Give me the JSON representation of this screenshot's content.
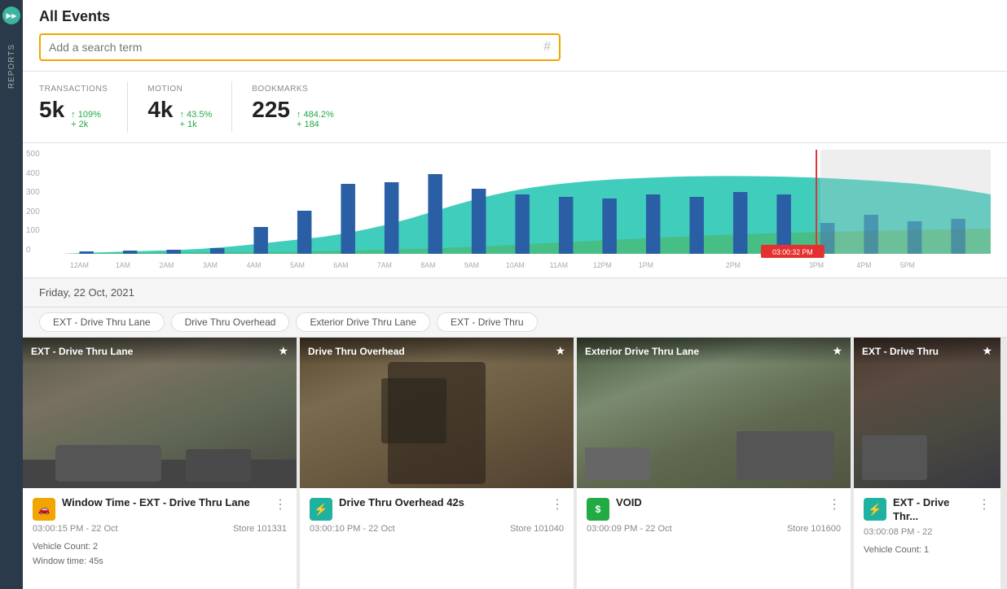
{
  "sidebar": {
    "toggle_label": "▶",
    "reports_label": "REPORTS"
  },
  "header": {
    "title": "All Events",
    "search_placeholder": "Add a search term",
    "search_hash": "#"
  },
  "stats": [
    {
      "label": "TRANSACTIONS",
      "value": "5k",
      "change1": "↑ 109%",
      "change2": "+ 2k"
    },
    {
      "label": "MOTION",
      "value": "4k",
      "change1": "↑ 43.5%",
      "change2": "+ 1k"
    },
    {
      "label": "BOOKMARKS",
      "value": "225",
      "change1": "↑ 484.2%",
      "change2": "+ 184"
    }
  ],
  "chart": {
    "y_labels": [
      "500",
      "400",
      "300",
      "200",
      "100",
      "0"
    ],
    "x_labels": [
      "12AM",
      "1AM",
      "2AM",
      "3AM",
      "4AM",
      "5AM",
      "6AM",
      "7AM",
      "8AM",
      "9AM",
      "10AM",
      "11AM",
      "12PM",
      "1PM",
      "2PM",
      "3PM",
      "4PM",
      "5PM"
    ],
    "tooltip_time": "03:00:32 PM",
    "cursor_pct": "78.5"
  },
  "date_bar": {
    "date": "Friday, 22 Oct, 2021"
  },
  "camera_tabs": [
    "EXT - Drive Thru Lane",
    "Drive Thru Overhead",
    "Exterior Drive Thru Lane",
    "EXT - Drive Thru"
  ],
  "video_cards": [
    {
      "title": "EXT - Drive Thru Lane",
      "event_name": "Window Time - EXT - Drive Thru Lane",
      "time": "03:00:15 PM - 22 Oct",
      "store": "Store 101331",
      "icon_type": "orange",
      "icon_symbol": "🚗",
      "detail1": "Vehicle Count: 2",
      "detail2": "Window time: 45s",
      "has_star": true
    },
    {
      "title": "Drive Thru Overhead",
      "event_name": "Drive Thru Overhead 42s",
      "time": "03:00:10 PM - 22 Oct",
      "store": "Store 101040",
      "icon_type": "teal",
      "icon_symbol": "⚡",
      "detail1": "",
      "detail2": "",
      "has_star": true
    },
    {
      "title": "Exterior Drive Thru Lane",
      "event_name": "VOID",
      "time": "03:00:09 PM - 22 Oct",
      "store": "Store 101600",
      "icon_type": "green",
      "icon_symbol": "$",
      "detail1": "",
      "detail2": "",
      "has_star": true
    },
    {
      "title": "EXT - Drive Thru",
      "event_name": "EXT - Drive Thr...",
      "time": "03:00:08 PM - 22",
      "store": "",
      "icon_type": "teal2",
      "icon_symbol": "⚡",
      "detail1": "Vehicle Count: 1",
      "detail2": "",
      "has_star": true
    }
  ]
}
